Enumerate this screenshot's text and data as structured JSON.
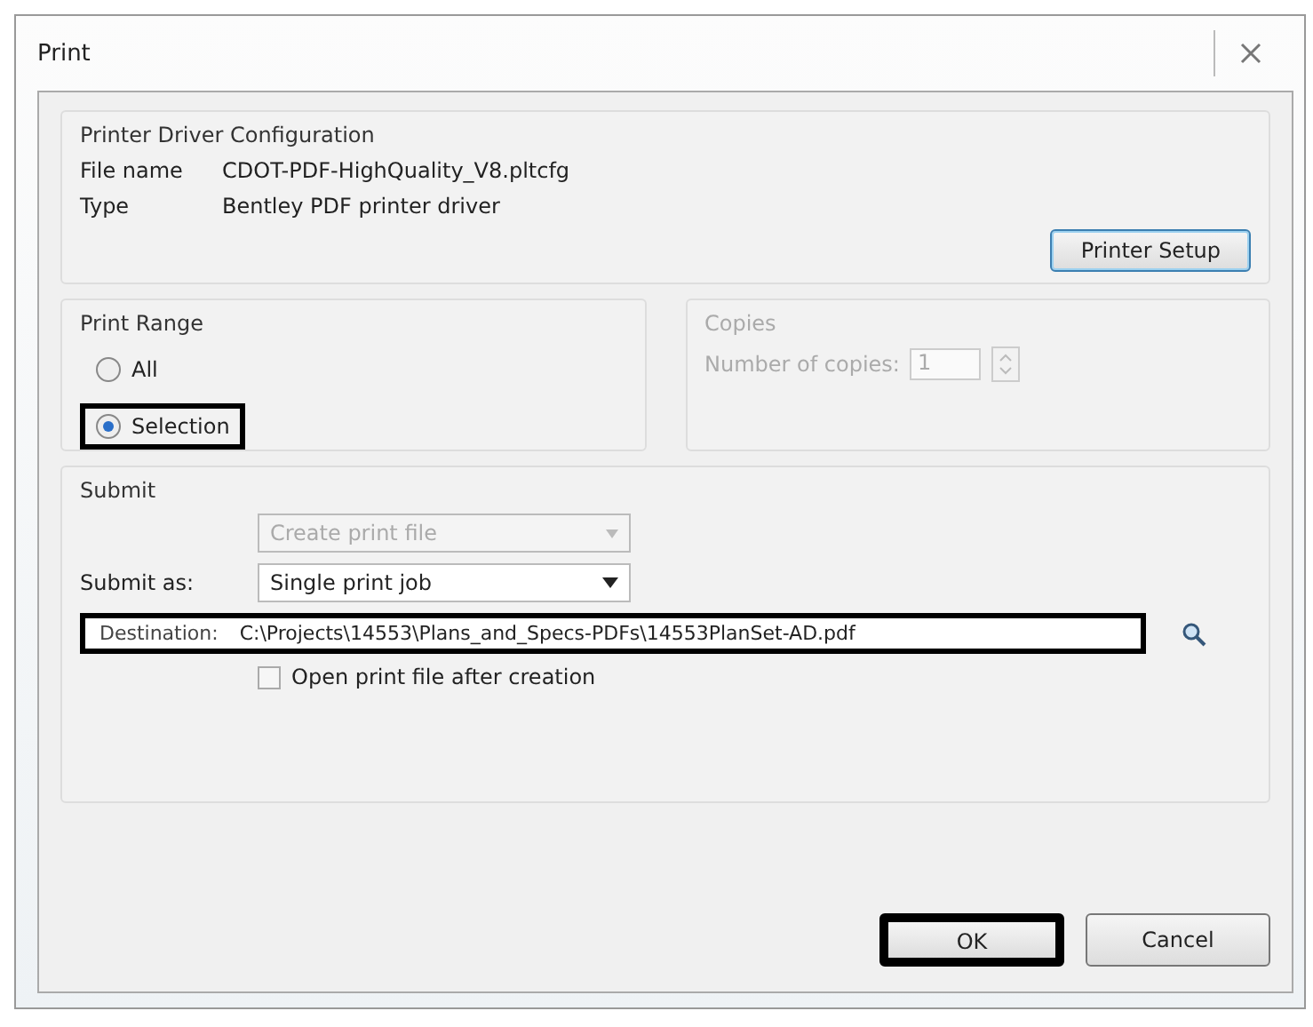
{
  "window": {
    "title": "Print"
  },
  "driver": {
    "title": "Printer Driver Configuration",
    "fields": [
      {
        "label": "File name",
        "value": "CDOT-PDF-HighQuality_V8.pltcfg"
      },
      {
        "label": "Type",
        "value": "Bentley PDF printer driver"
      }
    ],
    "setup_button": "Printer Setup"
  },
  "print_range": {
    "title": "Print Range",
    "options": [
      {
        "label": "All",
        "selected": false,
        "highlighted": false
      },
      {
        "label": "Selection",
        "selected": true,
        "highlighted": true
      }
    ]
  },
  "copies": {
    "title": "Copies",
    "disabled": true,
    "label": "Number of copies:",
    "value": "1"
  },
  "submit": {
    "title": "Submit",
    "mode": {
      "value": "Create print file",
      "disabled": true
    },
    "submit_as": {
      "label": "Submit as:",
      "value": "Single print job"
    },
    "destination": {
      "label": "Destination:",
      "value": "C:\\Projects\\14553\\Plans_and_Specs-PDFs\\14553PlanSet-AD.pdf",
      "highlighted": true
    },
    "open_after": {
      "label": "Open print file after creation",
      "checked": false
    }
  },
  "buttons": [
    {
      "label": "OK",
      "highlighted": true
    },
    {
      "label": "Cancel",
      "highlighted": false
    }
  ]
}
